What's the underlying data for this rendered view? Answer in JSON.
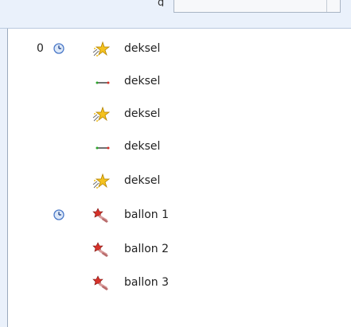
{
  "window": {
    "title_fragment": "g"
  },
  "animation_list": {
    "items": [
      {
        "index": "0",
        "trigger": "clock-icon",
        "effect": "sparkle-entrance-icon",
        "label": "deksel"
      },
      {
        "index": "",
        "trigger": "",
        "effect": "motion-path-line-icon",
        "label": "deksel"
      },
      {
        "index": "",
        "trigger": "",
        "effect": "sparkle-entrance-icon",
        "label": "deksel"
      },
      {
        "index": "",
        "trigger": "",
        "effect": "motion-path-line-icon",
        "label": "deksel"
      },
      {
        "index": "",
        "trigger": "",
        "effect": "sparkle-entrance-icon",
        "label": "deksel"
      },
      {
        "index": "",
        "trigger": "clock-icon",
        "effect": "star-emphasis-icon",
        "label": "ballon 1"
      },
      {
        "index": "",
        "trigger": "",
        "effect": "star-emphasis-icon",
        "label": "ballon 2"
      },
      {
        "index": "",
        "trigger": "",
        "effect": "star-emphasis-icon",
        "label": "ballon 3"
      }
    ]
  },
  "colors": {
    "background": "#ffffff",
    "chrome": "#eaf1fb",
    "border": "#9aa9bd",
    "clock_blue": "#4a78c8",
    "sparkle_yellow": "#f4c21f",
    "star_red": "#d6322a"
  }
}
